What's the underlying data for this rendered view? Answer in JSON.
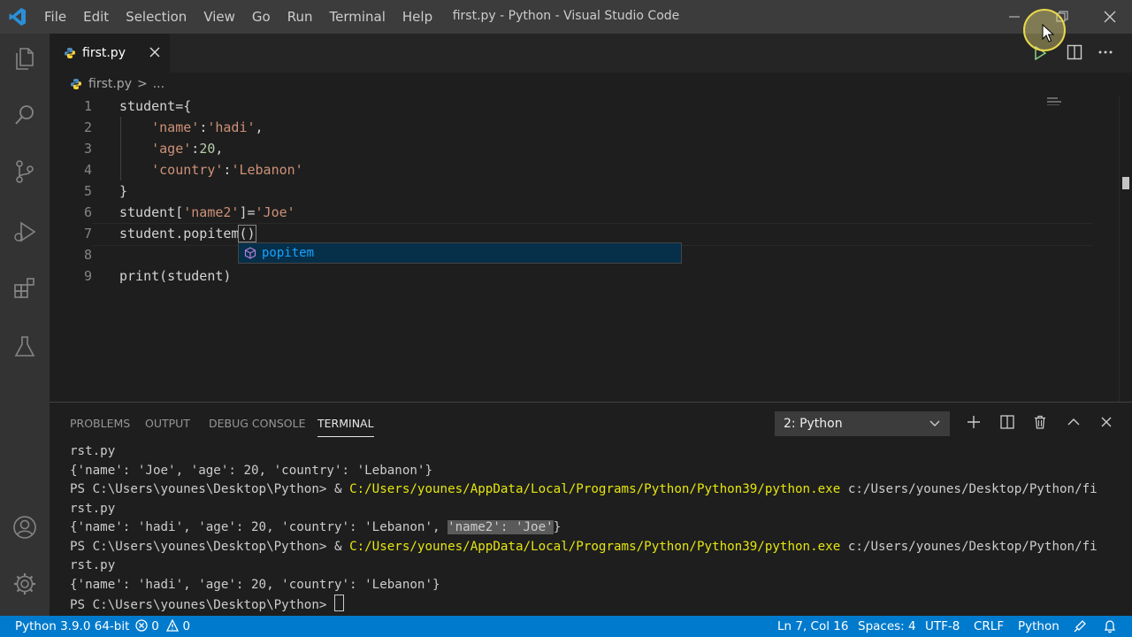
{
  "window": {
    "title": "first.py - Python - Visual Studio Code",
    "menu": [
      "File",
      "Edit",
      "Selection",
      "View",
      "Go",
      "Run",
      "Terminal",
      "Help"
    ]
  },
  "tab": {
    "label": "first.py"
  },
  "breadcrumb": {
    "file": "first.py",
    "sep": ">",
    "rest": "..."
  },
  "editor": {
    "line_numbers": [
      "1",
      "2",
      "3",
      "4",
      "5",
      "6",
      "7",
      "8",
      "9"
    ],
    "lines": [
      "student={",
      "    'name':'hadi',",
      "    'age':20,",
      "    'country':'Lebanon'",
      "}",
      "student['name2']='Joe'",
      "student.popitem()",
      "",
      "print(student)"
    ],
    "suggestion": "popitem"
  },
  "panel": {
    "tabs": [
      "PROBLEMS",
      "OUTPUT",
      "DEBUG CONSOLE",
      "TERMINAL"
    ],
    "active_tab": "TERMINAL",
    "terminal_select": "2: Python",
    "terminal": {
      "l1": "rst.py",
      "l2": "{'name': 'Joe', 'age': 20, 'country': 'Lebanon'}",
      "prompt": "PS C:\\Users\\younes\\Desktop\\Python> ",
      "amp": "& ",
      "exe": "C:/Users/younes/AppData/Local/Programs/Python/Python39/python.exe",
      "arg": " c:/Users/younes/Desktop/Python/fi",
      "l4": "rst.py",
      "l5a": "{'name': 'hadi', 'age': 20, 'country': 'Lebanon', ",
      "l5b": "'name2': 'Joe'",
      "l5c": "}",
      "l8": "{'name': 'hadi', 'age': 20, 'country': 'Lebanon'}",
      "final_prompt": "PS C:\\Users\\younes\\Desktop\\Python> "
    }
  },
  "statusbar": {
    "interpreter": "Python 3.9.0 64-bit",
    "errors": "0",
    "warnings": "0",
    "position": "Ln 7, Col 16",
    "spaces": "Spaces: 4",
    "encoding": "UTF-8",
    "eol": "CRLF",
    "language": "Python"
  },
  "colors": {
    "statusbar": "#007acc",
    "titlebar": "#3c3c3c",
    "activitybar": "#333333",
    "editor_bg": "#1e1e1e",
    "string": "#ce9178",
    "number": "#b5cea8",
    "terminal_path": "#e5e510"
  }
}
